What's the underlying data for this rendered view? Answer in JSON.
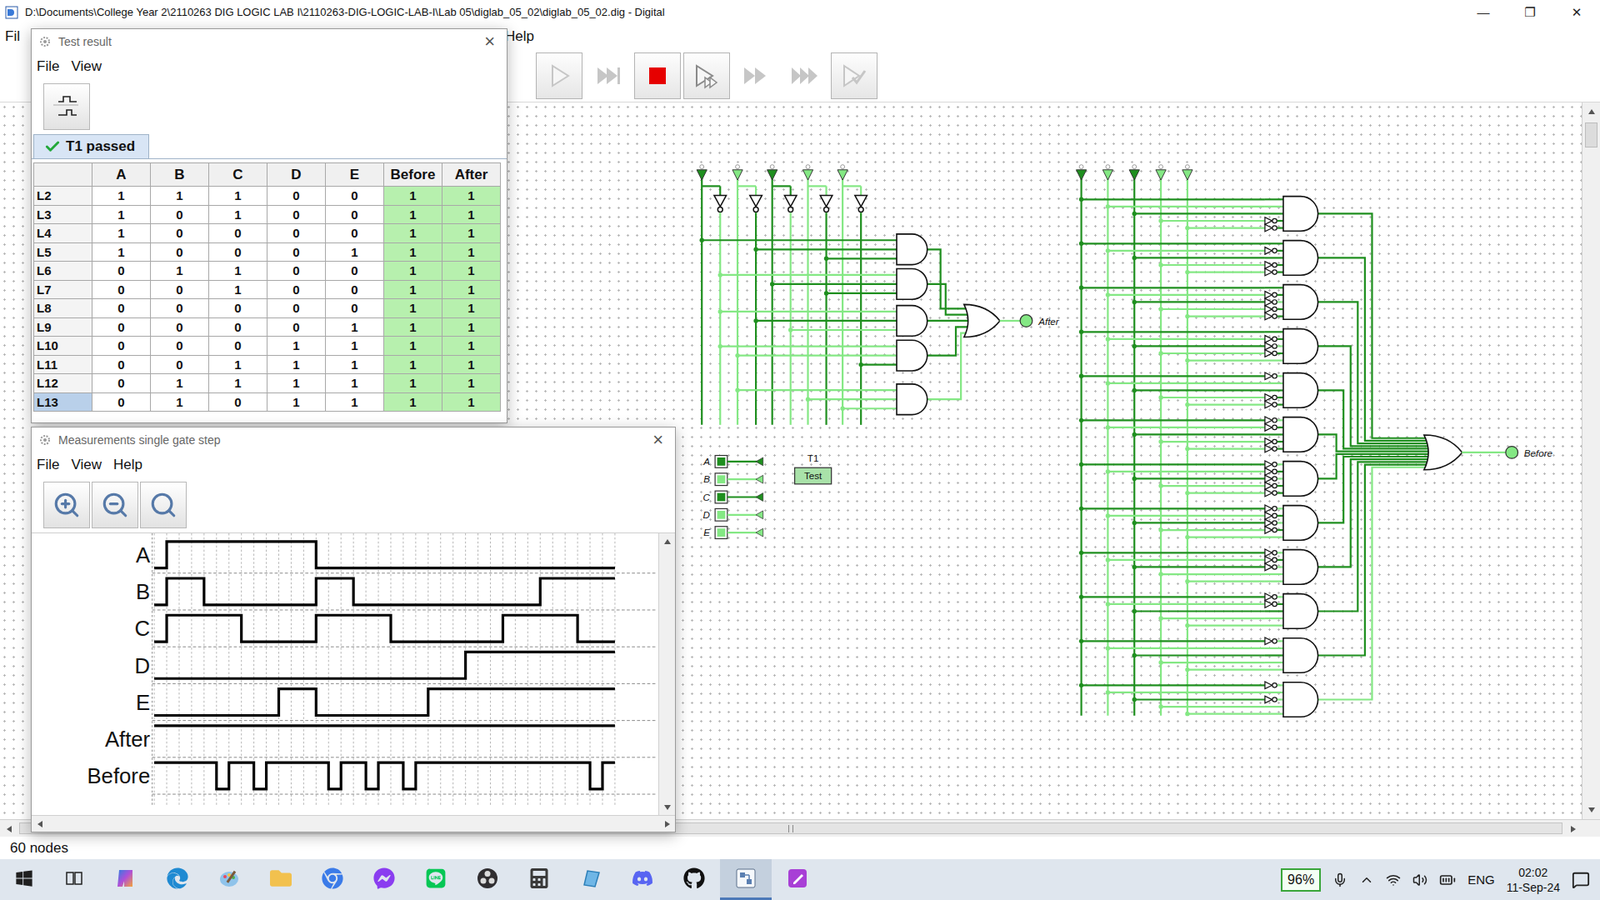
{
  "window": {
    "title": "D:\\Documents\\College Year 2\\2110263 DIG LOGIC LAB I\\2110263-DIG-LOGIC-LAB-I\\Lab 05\\diglab_05_02\\diglab_05_02.dig - Digital",
    "controls": [
      "—",
      "❐",
      "✕"
    ]
  },
  "menu": [
    "Fil",
    "Help"
  ],
  "toolbar": [
    {
      "kind": "run",
      "disabled": true,
      "raised": true
    },
    {
      "kind": "step",
      "disabled": true,
      "raised": false
    },
    {
      "kind": "stop",
      "disabled": false,
      "raised": true
    },
    {
      "kind": "micro",
      "disabled": false,
      "raised": true
    },
    {
      "kind": "fast",
      "disabled": true,
      "raised": false
    },
    {
      "kind": "faster",
      "disabled": true,
      "raised": false
    },
    {
      "kind": "test",
      "disabled": true,
      "raised": true
    }
  ],
  "circuit": {
    "inputs": [
      {
        "label": "A",
        "value": 0
      },
      {
        "label": "B",
        "value": 1
      },
      {
        "label": "C",
        "value": 0
      },
      {
        "label": "D",
        "value": 1
      },
      {
        "label": "E",
        "value": 1
      }
    ],
    "outputs": [
      {
        "label": "After",
        "value": 1
      },
      {
        "label": "Before",
        "value": 1
      }
    ],
    "test": {
      "label": "T1",
      "button": "Test"
    }
  },
  "status": "60 nodes",
  "testResult": {
    "title": "Test result",
    "close": "×",
    "menu": [
      "File",
      "View"
    ],
    "tab": {
      "label": "T1 passed",
      "passed": true
    },
    "columns": [
      {
        "label": "",
        "kind": "name"
      },
      {
        "label": "A",
        "kind": "input"
      },
      {
        "label": "B",
        "kind": "input"
      },
      {
        "label": "C",
        "kind": "input"
      },
      {
        "label": "D",
        "kind": "input"
      },
      {
        "label": "E",
        "kind": "input"
      },
      {
        "label": "Before",
        "kind": "output"
      },
      {
        "label": "After",
        "kind": "output"
      }
    ],
    "rows": [
      {
        "label": "L2",
        "values": [
          "1",
          "1",
          "1",
          "0",
          "0",
          "1",
          "1"
        ],
        "passed": true,
        "selected": false
      },
      {
        "label": "L3",
        "values": [
          "1",
          "0",
          "1",
          "0",
          "0",
          "1",
          "1"
        ],
        "passed": true,
        "selected": false
      },
      {
        "label": "L4",
        "values": [
          "1",
          "0",
          "0",
          "0",
          "0",
          "1",
          "1"
        ],
        "passed": true,
        "selected": false
      },
      {
        "label": "L5",
        "values": [
          "1",
          "0",
          "0",
          "0",
          "1",
          "1",
          "1"
        ],
        "passed": true,
        "selected": false
      },
      {
        "label": "L6",
        "values": [
          "0",
          "1",
          "1",
          "0",
          "0",
          "1",
          "1"
        ],
        "passed": true,
        "selected": false
      },
      {
        "label": "L7",
        "values": [
          "0",
          "0",
          "1",
          "0",
          "0",
          "1",
          "1"
        ],
        "passed": true,
        "selected": false
      },
      {
        "label": "L8",
        "values": [
          "0",
          "0",
          "0",
          "0",
          "0",
          "1",
          "1"
        ],
        "passed": true,
        "selected": false
      },
      {
        "label": "L9",
        "values": [
          "0",
          "0",
          "0",
          "0",
          "1",
          "1",
          "1"
        ],
        "passed": true,
        "selected": false
      },
      {
        "label": "L10",
        "values": [
          "0",
          "0",
          "0",
          "1",
          "1",
          "1",
          "1"
        ],
        "passed": true,
        "selected": false
      },
      {
        "label": "L11",
        "values": [
          "0",
          "0",
          "1",
          "1",
          "1",
          "1",
          "1"
        ],
        "passed": true,
        "selected": false
      },
      {
        "label": "L12",
        "values": [
          "0",
          "1",
          "1",
          "1",
          "1",
          "1",
          "1"
        ],
        "passed": true,
        "selected": false
      },
      {
        "label": "L13",
        "values": [
          "0",
          "1",
          "0",
          "1",
          "1",
          "1",
          "1"
        ],
        "passed": true,
        "selected": true
      }
    ]
  },
  "measurements": {
    "title": "Measurements single gate step",
    "close": "×",
    "menu": [
      "File",
      "View",
      "Help"
    ],
    "signals": [
      {
        "name": "A",
        "values": [
          0,
          1,
          1,
          1,
          1,
          1,
          1,
          1,
          1,
          1,
          1,
          1,
          1,
          0,
          0,
          0,
          0,
          0,
          0,
          0,
          0,
          0,
          0,
          0,
          0,
          0,
          0,
          0,
          0,
          0,
          0,
          0,
          0,
          0,
          0,
          0,
          0
        ]
      },
      {
        "name": "B",
        "values": [
          0,
          1,
          1,
          1,
          0,
          0,
          0,
          0,
          0,
          0,
          0,
          0,
          0,
          1,
          1,
          1,
          0,
          0,
          0,
          0,
          0,
          0,
          0,
          0,
          0,
          0,
          0,
          0,
          0,
          0,
          0,
          1,
          1,
          1,
          1,
          1,
          1
        ]
      },
      {
        "name": "C",
        "values": [
          0,
          1,
          1,
          1,
          1,
          1,
          1,
          0,
          0,
          0,
          0,
          0,
          0,
          1,
          1,
          1,
          1,
          1,
          1,
          0,
          0,
          0,
          0,
          0,
          0,
          0,
          0,
          0,
          1,
          1,
          1,
          1,
          1,
          1,
          0,
          0,
          0
        ]
      },
      {
        "name": "D",
        "values": [
          0,
          0,
          0,
          0,
          0,
          0,
          0,
          0,
          0,
          0,
          0,
          0,
          0,
          0,
          0,
          0,
          0,
          0,
          0,
          0,
          0,
          0,
          0,
          0,
          0,
          1,
          1,
          1,
          1,
          1,
          1,
          1,
          1,
          1,
          1,
          1,
          1
        ]
      },
      {
        "name": "E",
        "values": [
          0,
          0,
          0,
          0,
          0,
          0,
          0,
          0,
          0,
          0,
          1,
          1,
          1,
          0,
          0,
          0,
          0,
          0,
          0,
          0,
          0,
          0,
          1,
          1,
          1,
          1,
          1,
          1,
          1,
          1,
          1,
          1,
          1,
          1,
          1,
          1,
          1
        ]
      },
      {
        "name": "After",
        "values": [
          1,
          1,
          1,
          1,
          1,
          1,
          1,
          1,
          1,
          1,
          1,
          1,
          1,
          1,
          1,
          1,
          1,
          1,
          1,
          1,
          1,
          1,
          1,
          1,
          1,
          1,
          1,
          1,
          1,
          1,
          1,
          1,
          1,
          1,
          1,
          1,
          1
        ]
      },
      {
        "name": "Before",
        "values": [
          1,
          1,
          1,
          1,
          1,
          0,
          1,
          1,
          0,
          1,
          1,
          1,
          1,
          1,
          0,
          1,
          1,
          0,
          1,
          1,
          0,
          1,
          1,
          1,
          1,
          1,
          1,
          1,
          1,
          1,
          1,
          1,
          1,
          1,
          1,
          0,
          1
        ]
      }
    ]
  },
  "taskbar": {
    "apps": [
      {
        "selected": false
      },
      {
        "selected": false
      },
      {
        "selected": false
      },
      {
        "selected": false
      },
      {
        "selected": false
      },
      {
        "selected": false
      },
      {
        "selected": false
      },
      {
        "selected": false
      },
      {
        "selected": false
      },
      {
        "selected": false
      },
      {
        "selected": false
      },
      {
        "selected": false
      },
      {
        "selected": true
      },
      {
        "selected": false
      }
    ],
    "battery": "96%",
    "language": "ENG",
    "time": "02:02",
    "date": "11-Sep-24"
  }
}
